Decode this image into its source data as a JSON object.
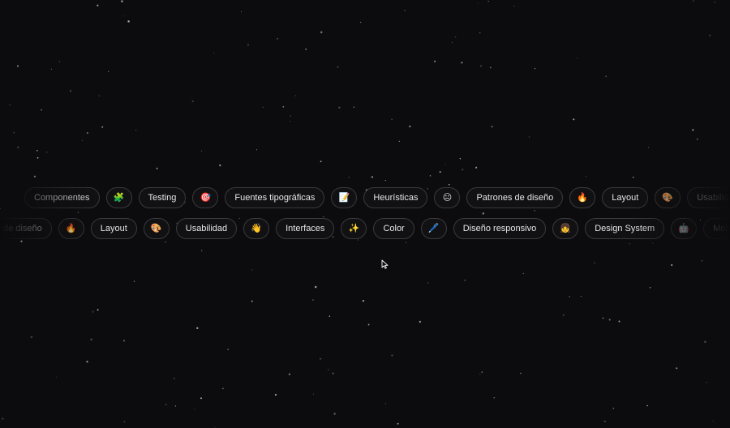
{
  "rows": [
    {
      "items": [
        {
          "type": "text",
          "label": "Componentes"
        },
        {
          "type": "icon",
          "glyph": "🧩",
          "icon": "puzzle-icon"
        },
        {
          "type": "text",
          "label": "Testing"
        },
        {
          "type": "icon",
          "glyph": "🎯",
          "icon": "target-icon"
        },
        {
          "type": "text",
          "label": "Fuentes tipográficas"
        },
        {
          "type": "icon",
          "glyph": "📝",
          "icon": "memo-icon"
        },
        {
          "type": "text",
          "label": "Heurísticas"
        },
        {
          "type": "icon",
          "glyph": "😐",
          "icon": "face-icon"
        },
        {
          "type": "text",
          "label": "Patrones de diseño"
        },
        {
          "type": "icon",
          "glyph": "🔥",
          "icon": "fire-icon"
        },
        {
          "type": "text",
          "label": "Layout"
        },
        {
          "type": "icon",
          "glyph": "🎨",
          "icon": "palette-icon"
        },
        {
          "type": "text",
          "label": "Usabilidad"
        },
        {
          "type": "icon",
          "glyph": "👋",
          "icon": "wave-icon"
        }
      ]
    },
    {
      "items": [
        {
          "type": "text",
          "label": "de diseño"
        },
        {
          "type": "icon",
          "glyph": "🔥",
          "icon": "fire-icon"
        },
        {
          "type": "text",
          "label": "Layout"
        },
        {
          "type": "icon",
          "glyph": "🎨",
          "icon": "palette-icon"
        },
        {
          "type": "text",
          "label": "Usabilidad"
        },
        {
          "type": "icon",
          "glyph": "👋",
          "icon": "wave-icon"
        },
        {
          "type": "text",
          "label": "Interfaces"
        },
        {
          "type": "icon",
          "glyph": "✨",
          "icon": "sparkles-icon"
        },
        {
          "type": "text",
          "label": "Color"
        },
        {
          "type": "icon",
          "glyph": "🖊️",
          "icon": "pen-icon"
        },
        {
          "type": "text",
          "label": "Diseño responsivo"
        },
        {
          "type": "icon",
          "glyph": "👧",
          "icon": "girl-icon"
        },
        {
          "type": "text",
          "label": "Design System"
        },
        {
          "type": "icon",
          "glyph": "🤖",
          "icon": "robot-icon"
        },
        {
          "type": "text",
          "label": "Mobile first"
        }
      ]
    }
  ],
  "colors": {
    "background": "#0c0c0e",
    "pill_border": "#3a3a3f",
    "pill_text": "#e6e6e8"
  }
}
